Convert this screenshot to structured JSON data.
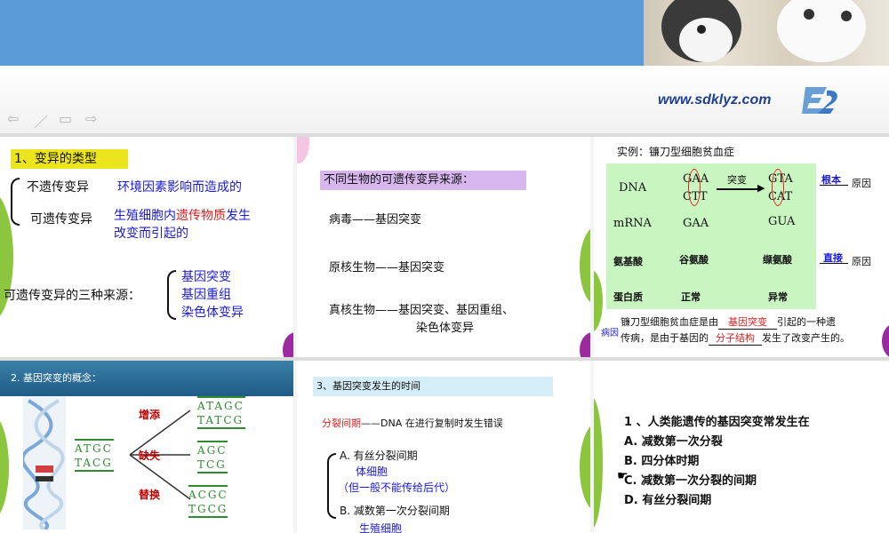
{
  "header": {
    "site_url": "www.sdklyz.com"
  },
  "nav": {
    "icons": [
      "back-arrow-icon",
      "pen-icon",
      "menu-icon",
      "forward-arrow-icon"
    ]
  },
  "slide1": {
    "title": "1、变异的类型",
    "nonheritable_label": "不遗传变异",
    "nonheritable_desc": "环境因素影响而造成的",
    "heritable_label": "可遗传变异",
    "heritable_desc_a": "生殖细胞内",
    "heritable_desc_b": "遗传物质",
    "heritable_desc_c": "发生",
    "heritable_desc_d": "改变而引起的",
    "sources_label": "可遗传变异的三种来源：",
    "sources": [
      "基因突变",
      "基因重组",
      "染色体变异"
    ]
  },
  "slide2": {
    "title": "不同生物的可遗传变异来源：",
    "lines": [
      "病毒——基因突变",
      "原核生物——基因突变"
    ],
    "eukaryote_a": "真核生物——基因突变、基因重组、",
    "eukaryote_b": "染色体变异"
  },
  "slide3": {
    "title": "实例：镰刀型细胞贫血症",
    "row_labels": [
      "DNA",
      "mRNA",
      "氨基酸",
      "蛋白质"
    ],
    "dna_normal_top": "GAA",
    "dna_normal_bottom": "CTT",
    "mutation_label": "突变",
    "dna_mutant_top": "GTA",
    "dna_mutant_bottom": "CAT",
    "mrna_normal": "GAA",
    "mrna_mutant": "GUA",
    "aa_normal": "谷氨酸",
    "aa_mutant": "缬氨酸",
    "protein_normal": "正常",
    "protein_mutant": "异常",
    "root_cause_answer": "根本",
    "root_cause_label": "原因",
    "direct_cause_answer": "直接",
    "direct_cause_label": "原因",
    "cause_tag": "病因",
    "summary_a": "镰刀型细胞贫血症是由",
    "summary_blank1": "基因突变",
    "summary_b": "引起的一种遗",
    "summary_c": "传病，是由于基因的",
    "summary_blank2": "分子结构",
    "summary_d": "发生了改变产生的。"
  },
  "slide4": {
    "title": "2.  基因突变的概念：",
    "original_top": "ATGC",
    "original_bottom": "TACG",
    "ops": [
      "增添",
      "缺失",
      "替换"
    ],
    "add_top": "ATAGC",
    "add_bottom": "TATCG",
    "del_top": "AGC",
    "del_bottom": "TCG",
    "sub_top": "ACGC",
    "sub_bottom": "TGCG"
  },
  "slide5": {
    "title": "3、基因突变发生的时间",
    "interphase_label": "分裂间期",
    "interphase_desc": "——DNA 在进行复制时发生错误",
    "option_a": "A. 有丝分裂间期",
    "somatic": "体细胞",
    "note": "（但一般不能传给后代）",
    "option_b": "B. 减数第一次分裂间期",
    "germ": "生殖细胞"
  },
  "slide6": {
    "question": "1 、人类能遗传的基因突变常发生在",
    "options": [
      "A. 减数第一次分裂",
      "B. 四分体时期",
      "C. 减数第一次分裂的间期",
      "D. 有丝分裂间期"
    ]
  }
}
